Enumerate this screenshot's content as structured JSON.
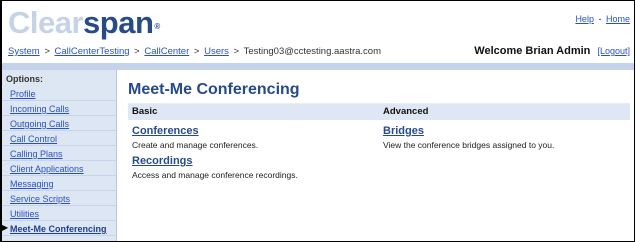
{
  "brand": {
    "logo_light": "Clear",
    "logo_dark": "span",
    "logo_mark": "®"
  },
  "top_links": {
    "help": "Help",
    "separator": "-",
    "home": "Home"
  },
  "breadcrumb": {
    "items": [
      "System",
      "CallCenterTesting",
      "CallCenter",
      "Users"
    ],
    "separator": ">",
    "current": "Testing03@cctesting.aastra.com"
  },
  "welcome": {
    "text": "Welcome Brian Admin",
    "logout": "[Logout]"
  },
  "sidebar": {
    "title": "Options:",
    "items": [
      {
        "label": "Profile"
      },
      {
        "label": "Incoming Calls"
      },
      {
        "label": "Outgoing Calls"
      },
      {
        "label": "Call Control"
      },
      {
        "label": "Calling Plans"
      },
      {
        "label": "Client Applications"
      },
      {
        "label": "Messaging"
      },
      {
        "label": "Service Scripts"
      },
      {
        "label": "Utilities"
      },
      {
        "label": "Meet-Me Conferencing"
      }
    ],
    "active_bullet": "▶"
  },
  "main": {
    "title": "Meet-Me Conferencing",
    "basic": {
      "heading": "Basic",
      "items": [
        {
          "link": "Conferences",
          "desc": "Create and manage conferences."
        },
        {
          "link": "Recordings",
          "desc": "Access and manage conference recordings."
        }
      ]
    },
    "advanced": {
      "heading": "Advanced",
      "items": [
        {
          "link": "Bridges",
          "desc": "View the conference bridges assigned to you."
        }
      ]
    }
  },
  "colors": {
    "brand_dark": "#274b89",
    "brand_light": "#c6d2e6",
    "link": "#2a52be",
    "sidebar_bg": "#dde6f3",
    "header_band": "#c4d3ea"
  }
}
